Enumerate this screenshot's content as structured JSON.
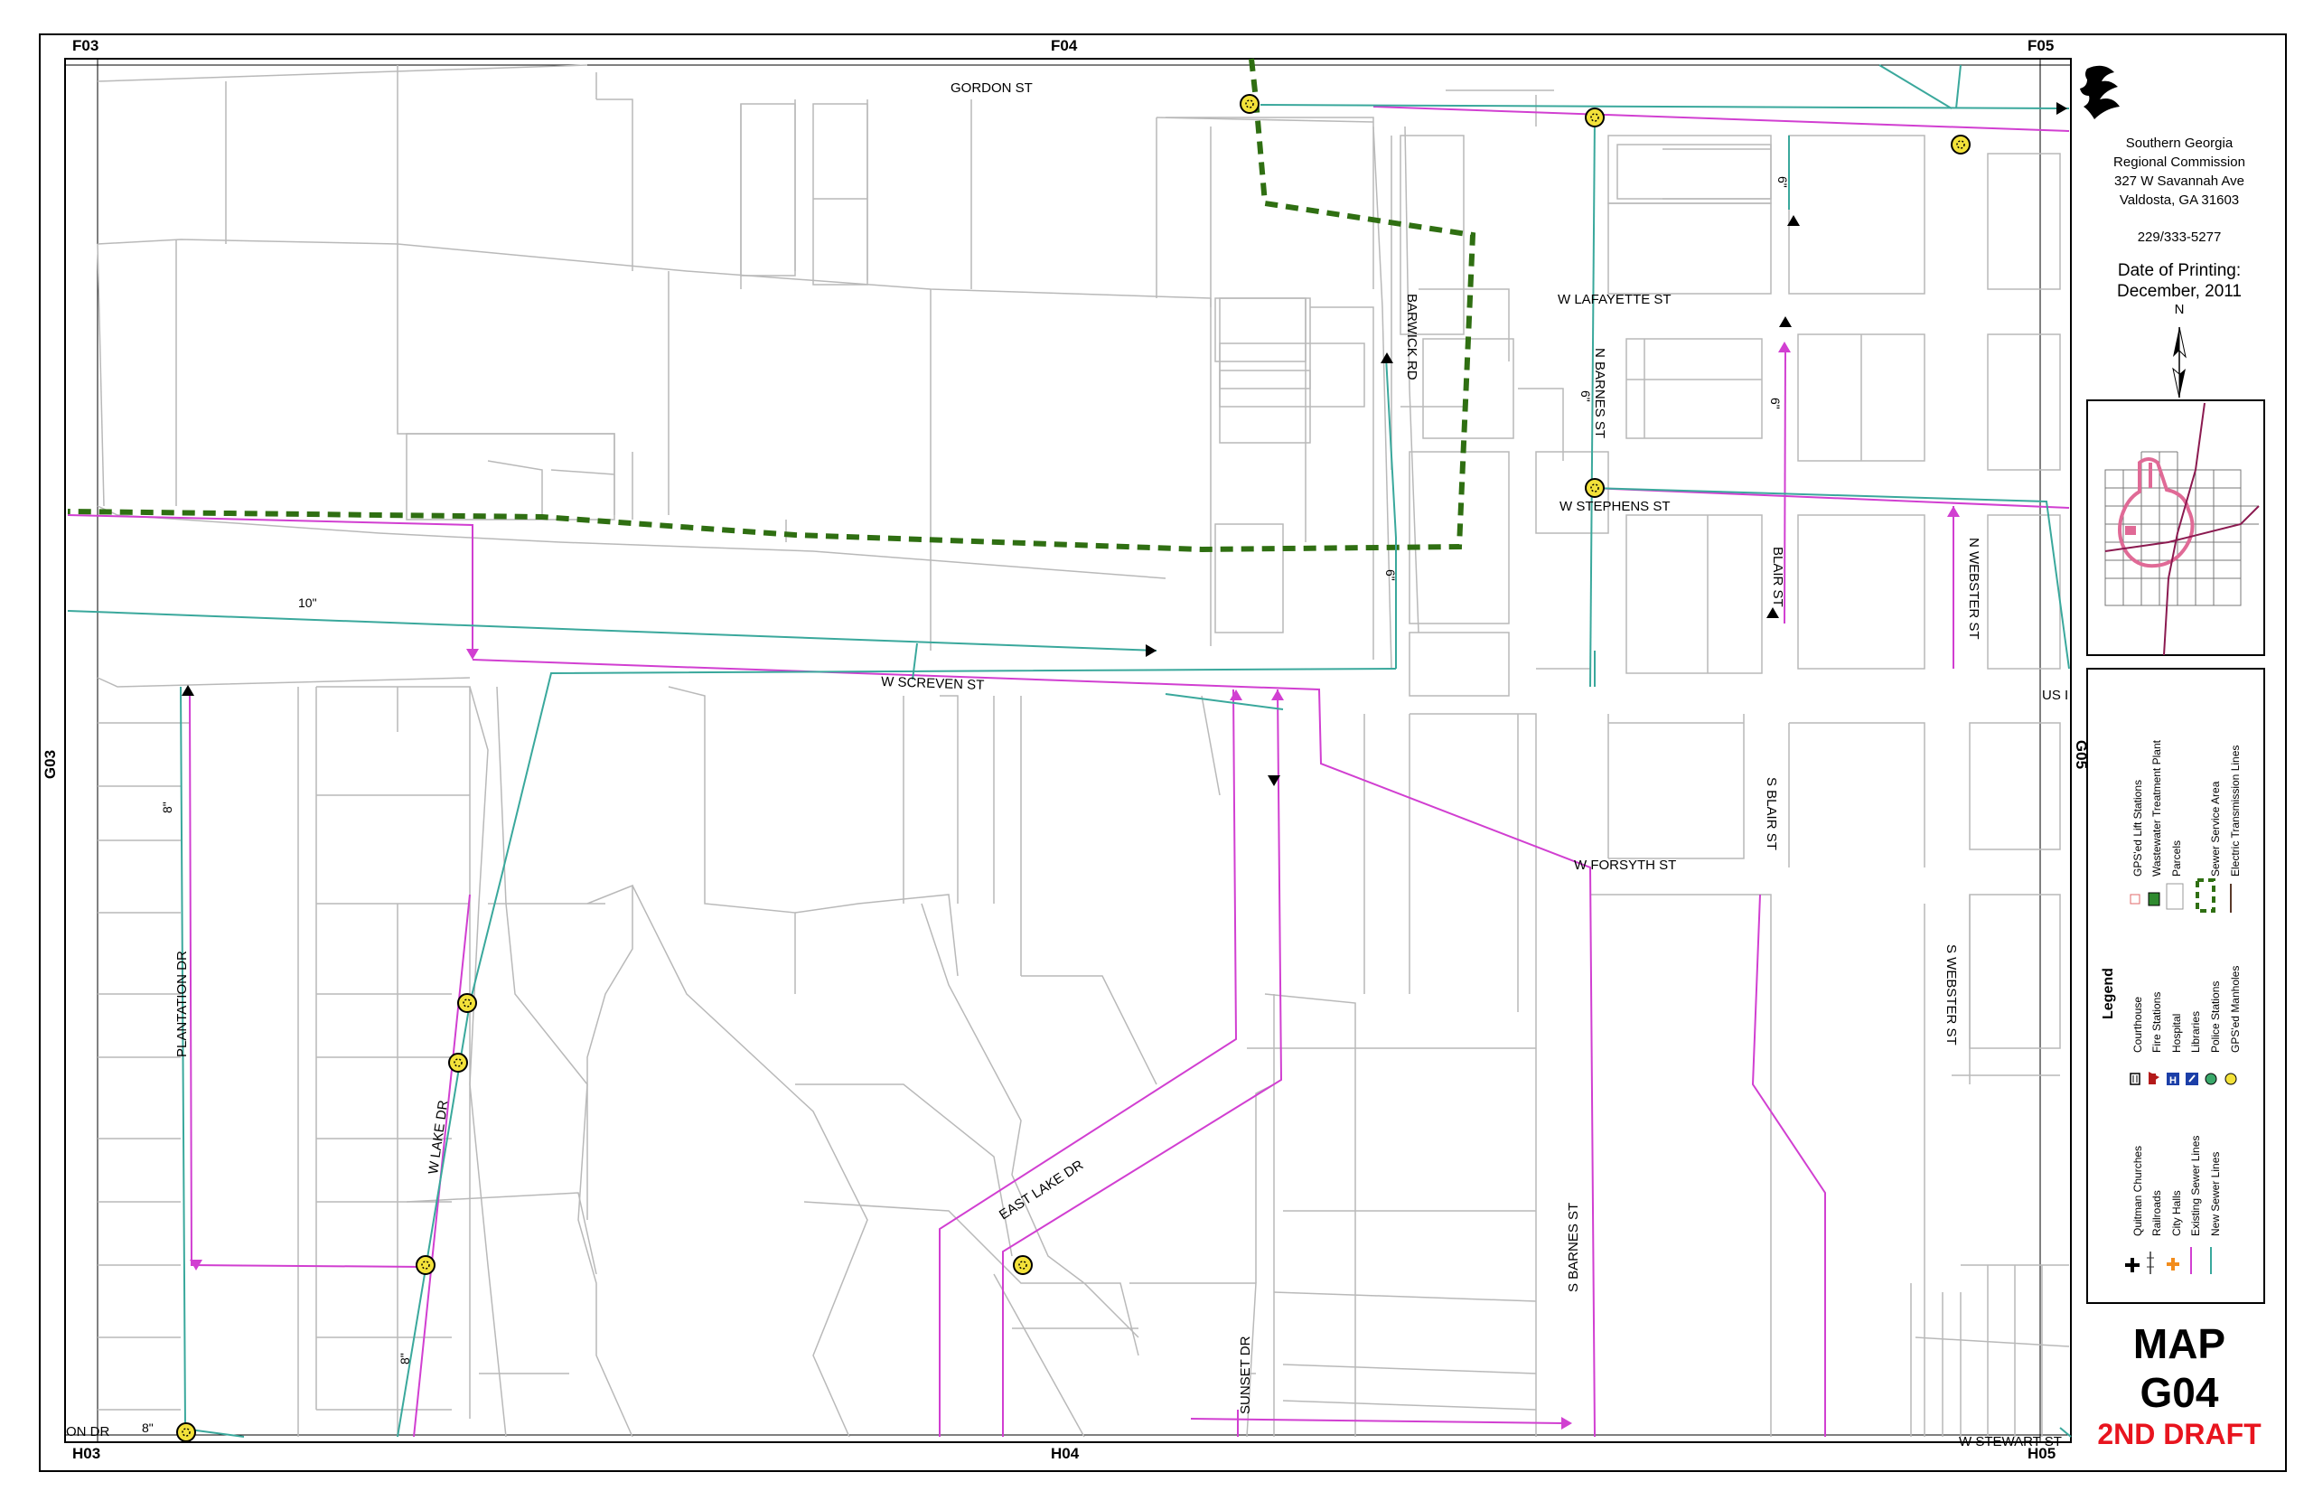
{
  "grid": {
    "top_left": "F03",
    "top_center": "F04",
    "top_right": "F05",
    "bottom_left": "H03",
    "bottom_center": "H04",
    "bottom_right": "H05",
    "left": "G03",
    "right": "G05"
  },
  "streets": {
    "gordon": "GORDON ST",
    "lafayette": "W LAFAYETTE ST",
    "stephens": "W STEPHENS ST",
    "screven": "W SCREVEN ST",
    "forsyth": "W FORSYTH ST",
    "barwick": "BARWICK RD",
    "n_barnes": "N BARNES ST",
    "blair": "BLAIR ST",
    "n_webster": "N WEBSTER ST",
    "s_blair": "S BLAIR ST",
    "s_webster": "S WEBSTER ST",
    "plantation": "PLANTATION DR",
    "w_lake": "W LAKE DR",
    "east_lake": "EAST LAKE DR",
    "sunset": "SUNSET DR",
    "s_barnes": "S BARNES ST",
    "us": "US I",
    "on_dr": "ON DR",
    "w_stewart": "W STEWART ST"
  },
  "pipe_sizes": {
    "p10": "10\"",
    "p8a": "8\"",
    "p8b": "8\"",
    "p8c": "8\"",
    "p6a": "6\"",
    "p6b": "6\"",
    "p6c": "6\"",
    "p6d": "6\""
  },
  "sidebar": {
    "org_line1": "Southern Georgia",
    "org_line2": "Regional Commission",
    "address1": "327 W Savannah Ave",
    "address2": "Valdosta, GA  31603",
    "phone": "229/333-5277",
    "print_label": "Date of Printing:",
    "print_date": "December, 2011",
    "north": "N",
    "map_label": "MAP",
    "map_id": "G04",
    "draft": "2ND DRAFT"
  },
  "legend": {
    "title": "Legend",
    "items": [
      "Quitman Churches",
      "Railroads",
      "City Halls",
      "Existing Sewer Lines",
      "New Sewer Lines",
      "Courthouse",
      "Fire Stations",
      "Hospital",
      "Libraries",
      "Police Stations",
      "GPS'ed Manholes",
      "GPS'ed Lift Stations",
      "Wastewater Treatment Plant",
      "Parcels",
      "Sewer Service Area",
      "Electric Transmission Lines"
    ]
  },
  "colors": {
    "parcel": "#b9b9b9",
    "existing_sewer": "#d13fd1",
    "new_sewer": "#3aa89c",
    "service_area": "#2f6f12",
    "manhole_fill": "#f3e23a",
    "draft_red": "#e8141e"
  }
}
